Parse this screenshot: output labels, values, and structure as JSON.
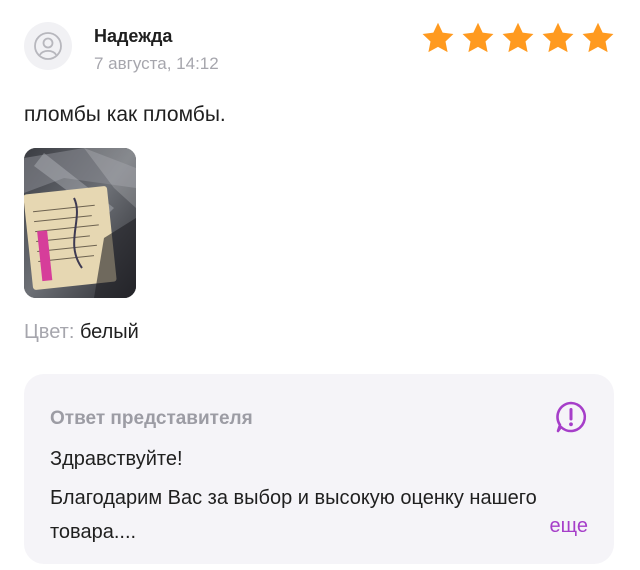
{
  "review": {
    "author": "Надежда",
    "date": "7 августа, 14:12",
    "rating": 5,
    "star_color": "#ff9a1f",
    "text": "пломбы как пломбы.",
    "photo_icon": "product-photo",
    "color_label": "Цвет:",
    "color_value": "белый"
  },
  "reply": {
    "title": "Ответ представителя",
    "greeting": "Здравствуйте!",
    "body": "Благодарим Вас за выбор и высокую оценку нашего товара....",
    "more_label": "еще",
    "accent_color": "#a63ec9",
    "icon": "exclamation-bubble-icon"
  }
}
